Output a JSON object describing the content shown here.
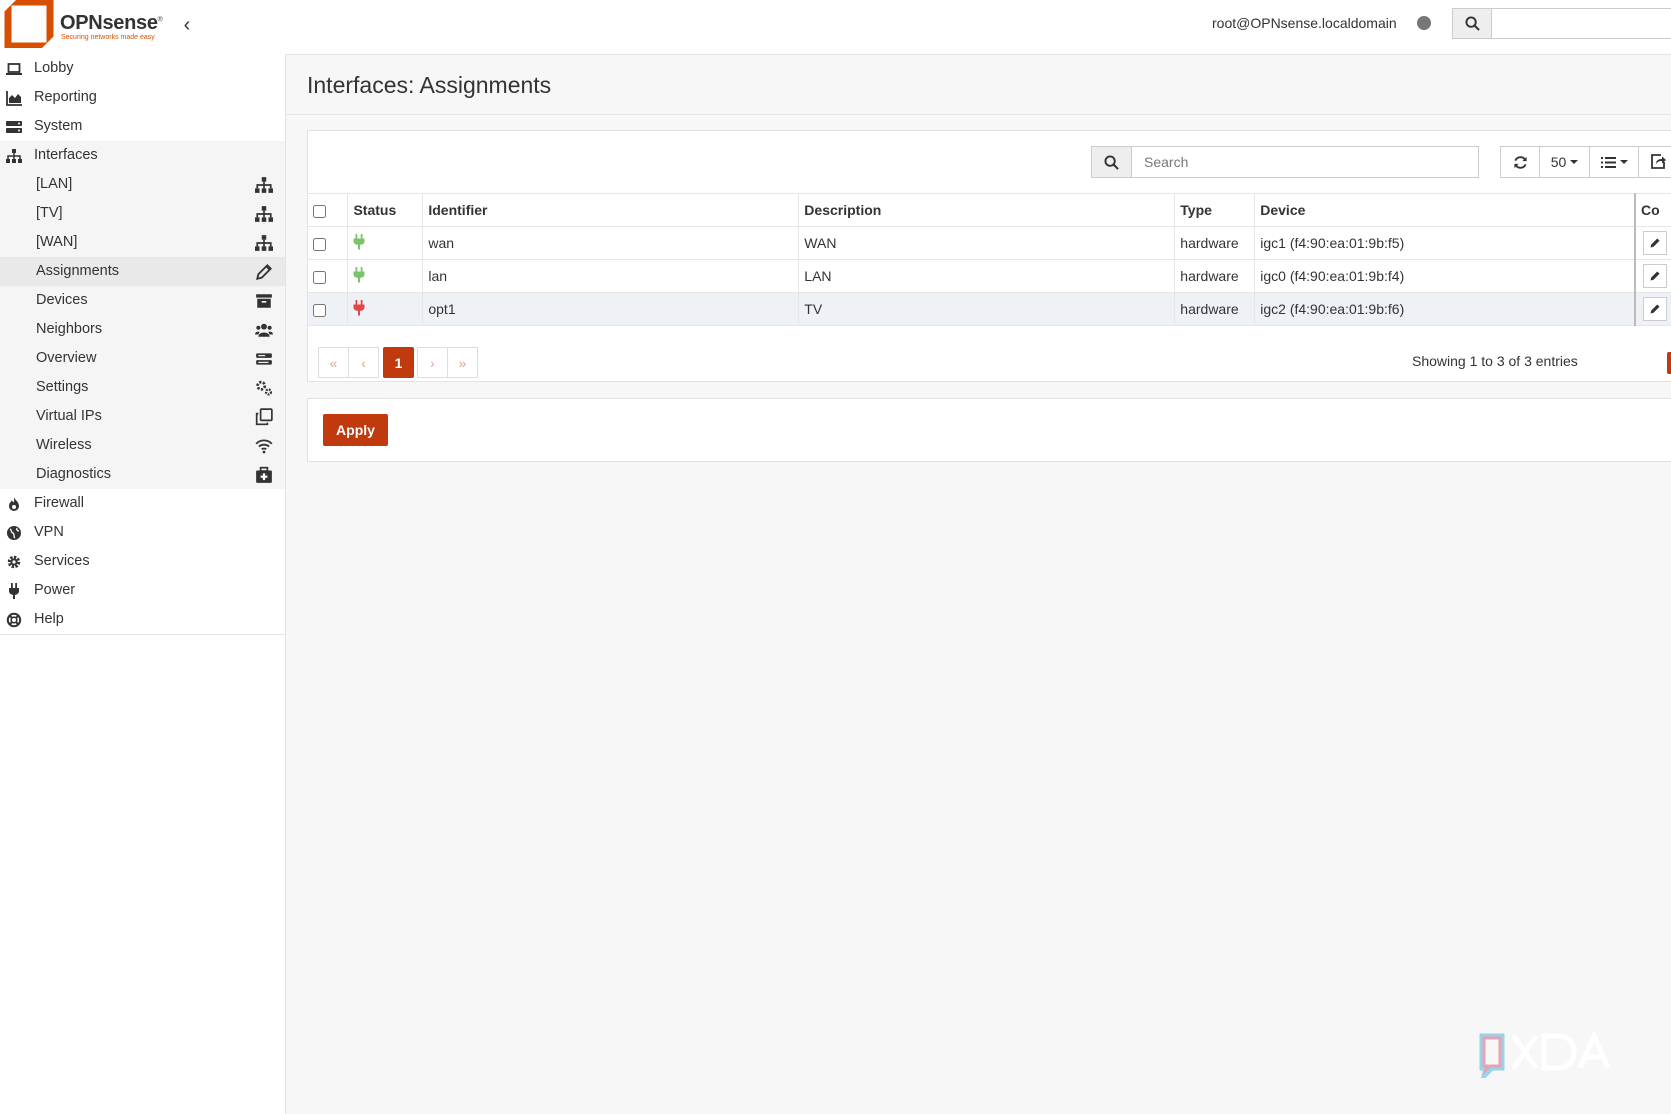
{
  "brand": {
    "name": "OPNsense",
    "tagline": "Securing networks made easy"
  },
  "header": {
    "user": "root@OPNsense.localdomain",
    "search_placeholder": ""
  },
  "sidebar": {
    "top_items": [
      {
        "label": "Lobby",
        "icon": "laptop-icon"
      },
      {
        "label": "Reporting",
        "icon": "area-chart-icon"
      },
      {
        "label": "System",
        "icon": "server-icon"
      },
      {
        "label": "Interfaces",
        "icon": "sitemap-icon"
      }
    ],
    "interfaces_sub": [
      {
        "label": "[LAN]",
        "icon": "sitemap-icon"
      },
      {
        "label": "[TV]",
        "icon": "sitemap-icon"
      },
      {
        "label": "[WAN]",
        "icon": "sitemap-icon"
      },
      {
        "label": "Assignments",
        "icon": "pencil-icon"
      },
      {
        "label": "Devices",
        "icon": "archive-icon"
      },
      {
        "label": "Neighbors",
        "icon": "users-icon"
      },
      {
        "label": "Overview",
        "icon": "tasks-icon"
      },
      {
        "label": "Settings",
        "icon": "cogs-icon"
      },
      {
        "label": "Virtual IPs",
        "icon": "clone-icon"
      },
      {
        "label": "Wireless",
        "icon": "wifi-icon"
      },
      {
        "label": "Diagnostics",
        "icon": "medkit-icon"
      }
    ],
    "bottom_items": [
      {
        "label": "Firewall",
        "icon": "fire-icon"
      },
      {
        "label": "VPN",
        "icon": "globe-icon"
      },
      {
        "label": "Services",
        "icon": "cog-icon"
      },
      {
        "label": "Power",
        "icon": "plug-icon"
      },
      {
        "label": "Help",
        "icon": "life-ring-icon"
      }
    ]
  },
  "page": {
    "title": "Interfaces: Assignments"
  },
  "grid": {
    "search_placeholder": "Search",
    "page_size": "50",
    "columns": [
      "Status",
      "Identifier",
      "Description",
      "Type",
      "Device",
      "Co"
    ],
    "rows": [
      {
        "status": "up",
        "identifier": "wan",
        "description": "WAN",
        "type": "hardware",
        "device": "igc1 (f4:90:ea:01:9b:f5)"
      },
      {
        "status": "up",
        "identifier": "lan",
        "description": "LAN",
        "type": "hardware",
        "device": "igc0 (f4:90:ea:01:9b:f4)"
      },
      {
        "status": "down",
        "identifier": "opt1",
        "description": "TV",
        "type": "hardware",
        "device": "igc2 (f4:90:ea:01:9b:f6)"
      }
    ],
    "pagination": {
      "first": "«",
      "prev": "‹",
      "current": "1",
      "next": "›",
      "last": "»",
      "info": "Showing 1 to 3 of 3 entries"
    }
  },
  "apply_label": "Apply",
  "watermark": "XDA",
  "colors": {
    "accent": "#c03a0e",
    "status_up": "#7cc36b",
    "status_down": "#e04848"
  }
}
